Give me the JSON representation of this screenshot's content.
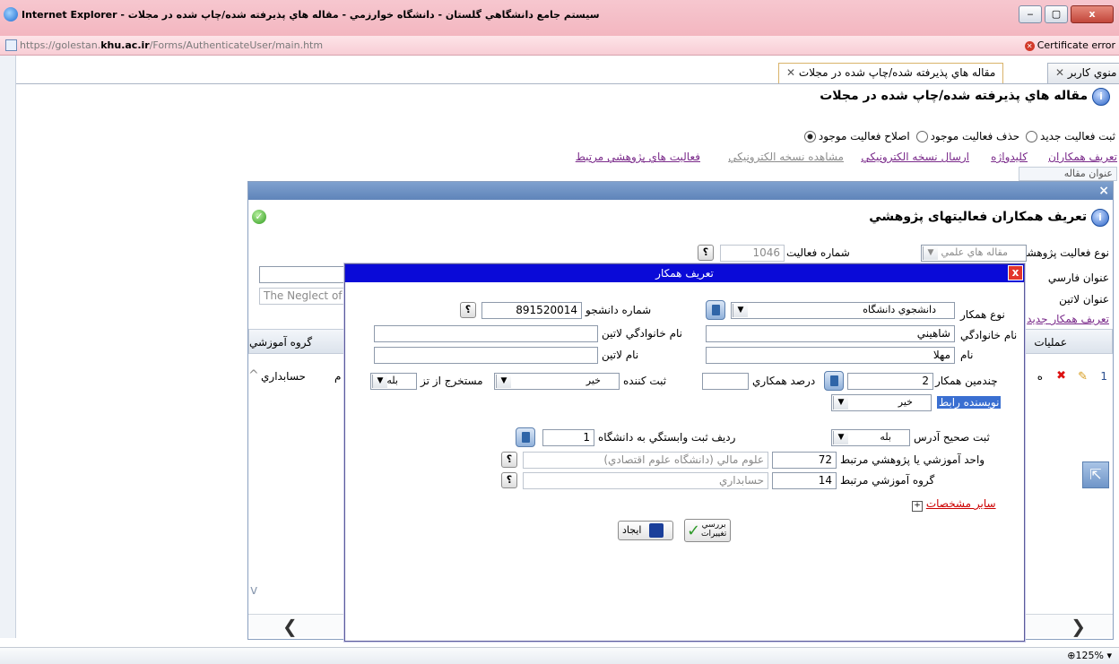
{
  "window": {
    "title": "Internet Explorer - سيستم جامع دانشگاهي گلستان - دانشگاه خوارزمي - مقاله هاي پذيرفته شده/چاپ شده در مجلات",
    "minimize": "‒",
    "maximize": "▢",
    "close": "x"
  },
  "addressbar": {
    "url_prefix": "https://golestan.",
    "url_domain": "khu.ac.ir",
    "url_suffix": "/Forms/AuthenticateUser/main.htm",
    "cert": "Certificate error"
  },
  "tabs": [
    {
      "label": "منوي کاربر"
    },
    {
      "label": "مقاله هاي پذيرفته شده/چاپ شده در مجلات"
    }
  ],
  "page": {
    "title": "مقاله هاي پذيرفته شده/چاپ شده در مجلات",
    "radios": [
      "ثبت فعاليت جديد",
      "حذف فعاليت موجود",
      "اصلاح فعاليت موجود"
    ],
    "links": [
      "تعريف همکاران",
      "کليدواژه",
      "ارسال نسخه الکترونيکي",
      "مشاهده نسخه الکترونيکي",
      "فعاليت هاي پژوهشي مرتبط"
    ],
    "article_title_label": "عنوان مقاله"
  },
  "dialog1": {
    "close": "×",
    "title": "تعريف همکاران فعالیتهای پژوهشي",
    "activity_type_label": "نوع فعاليت پژوهشي",
    "activity_type_value": "مقاله هاي علمي",
    "activity_no_label": "شماره فعاليت",
    "activity_no_value": "1046",
    "farsi_title_label": "عنوان فارسي",
    "latin_title_label": "عنوان لاتين",
    "latin_title_value": "The Neglect of",
    "define_link": "تعريف همکار جديد",
    "col_ops": "عمليات",
    "col_group": "گروه آموزشي",
    "row_no": "1",
    "row_h": "ه",
    "row_m": "م",
    "row_group": "حسابداري",
    "nav_left": "❮",
    "nav_right": "❯"
  },
  "dialog2": {
    "title": "تعريف همکار",
    "close": "x",
    "type_label": "نوع همکار",
    "type_value": "دانشجوي دانشگاه",
    "student_no_label": "شماره دانشجو",
    "student_no_value": "891520014",
    "family_label": "نام خانوادگي",
    "family_value": "شاهيني",
    "family_latin_label": "نام خانوادگي لاتين",
    "name_label": "نام",
    "name_value": "مهلا",
    "name_latin_label": "نام لاتين",
    "order_label": "چندمين همکار",
    "order_value": "2",
    "percent_label": "درصد همکاري",
    "registrar_label": "ثبت کننده",
    "registrar_value": "خير",
    "extracted_label": "مستخرج از تز",
    "extracted_value": "بله",
    "corresponding_label": "نويسنده رابط",
    "corresponding_value": "خير",
    "address_label": "ثبت صحيح آدرس",
    "address_value": "بله",
    "affil_row_label": "رديف ثبت وابستگي به دانشگاه",
    "affil_row_value": "1",
    "unit_label": "واحد آموزشي يا پژوهشي مرتبط",
    "unit_code": "72",
    "unit_name": "علوم مالي (دانشگاه علوم اقتصادي)",
    "group_label": "گروه آموزشي مرتبط",
    "group_code": "14",
    "group_name": "حسابداري",
    "more_label": "ساير مشخصات",
    "create_btn": "ايجاد",
    "check_btn_1": "بررسي",
    "check_btn_2": "تغييرات",
    "help": "؟"
  },
  "statusbar": {
    "zoom": "125%"
  }
}
